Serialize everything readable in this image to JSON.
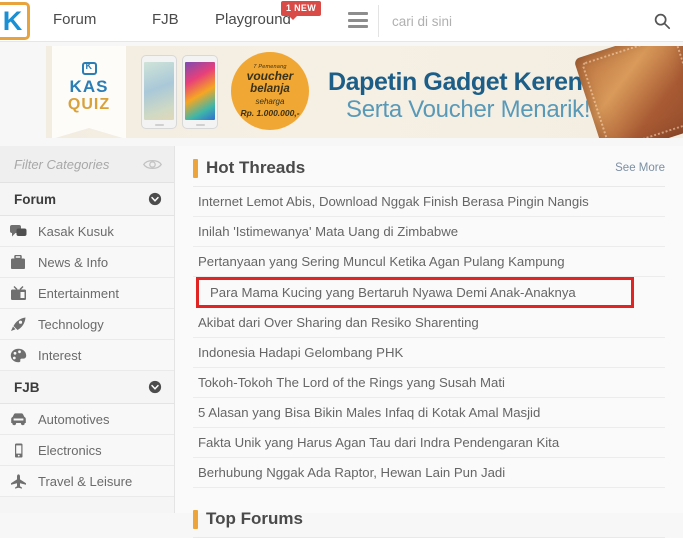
{
  "header": {
    "logo": "K",
    "nav": [
      {
        "label": "Forum",
        "name": "nav-forum"
      },
      {
        "label": "FJB",
        "name": "nav-fjb"
      },
      {
        "label": "Playground",
        "name": "nav-playground"
      }
    ],
    "badge": "1 NEW",
    "search": {
      "value": "",
      "placeholder": "cari di sini"
    },
    "icons": {
      "hamburger": "hamburger-icon",
      "search": "search-icon"
    }
  },
  "banner": {
    "kasquiz": {
      "line1": "KAS",
      "line2": "QUIZ"
    },
    "voucher": {
      "l1": "7 Pemenang",
      "l2": "voucher",
      "l3": "belanja",
      "l4": "seharga",
      "l5": "Rp. 1.000.000,-"
    },
    "headline": "Dapetin Gadget Keren",
    "subhead": "Serta Voucher Menarik!"
  },
  "sidebar": {
    "filter": {
      "placeholder": "Filter Categories",
      "value": "",
      "eye_icon": "eye-icon"
    },
    "sections": [
      {
        "title": "Forum",
        "items": [
          {
            "label": "Kasak Kusuk",
            "icon": "chat-bubbles-icon"
          },
          {
            "label": "News & Info",
            "icon": "briefcase-icon"
          },
          {
            "label": "Entertainment",
            "icon": "television-icon"
          },
          {
            "label": "Technology",
            "icon": "rocket-icon"
          },
          {
            "label": "Interest",
            "icon": "palette-icon"
          }
        ]
      },
      {
        "title": "FJB",
        "items": [
          {
            "label": "Automotives",
            "icon": "car-icon"
          },
          {
            "label": "Electronics",
            "icon": "mobile-phone-icon"
          },
          {
            "label": "Travel & Leisure",
            "icon": "airplane-icon"
          }
        ]
      }
    ]
  },
  "main": {
    "hot_threads": {
      "title": "Hot Threads",
      "see_more": "See More",
      "threads": [
        {
          "title": "Internet Lemot Abis, Download Nggak Finish Berasa Pingin Nangis",
          "highlighted": false
        },
        {
          "title": "Inilah 'Istimewanya' Mata Uang di Zimbabwe",
          "highlighted": false
        },
        {
          "title": "Pertanyaan yang Sering Muncul Ketika Agan Pulang Kampung",
          "highlighted": false
        },
        {
          "title": "Para Mama Kucing yang Bertaruh Nyawa Demi Anak-Anaknya",
          "highlighted": true
        },
        {
          "title": "Akibat dari Over Sharing dan Resiko Sharenting",
          "highlighted": false
        },
        {
          "title": "Indonesia Hadapi Gelombang PHK",
          "highlighted": false
        },
        {
          "title": "Tokoh-Tokoh The Lord of the Rings yang Susah Mati",
          "highlighted": false
        },
        {
          "title": "5 Alasan yang Bisa Bikin Males Infaq di Kotak Amal Masjid",
          "highlighted": false
        },
        {
          "title": "Fakta Unik yang Harus Agan Tau dari Indra Pendengaran Kita",
          "highlighted": false
        },
        {
          "title": "Berhubung Nggak Ada Raptor, Hewan Lain Pun Jadi",
          "highlighted": false
        }
      ]
    },
    "top_forums": {
      "title": "Top Forums"
    }
  },
  "colors": {
    "accent_orange": "#eda43a",
    "brand_blue": "#1a8fd4",
    "badge_red": "#d94b46",
    "highlight_red": "#e02424",
    "banner_blue": "#1c5e88"
  }
}
